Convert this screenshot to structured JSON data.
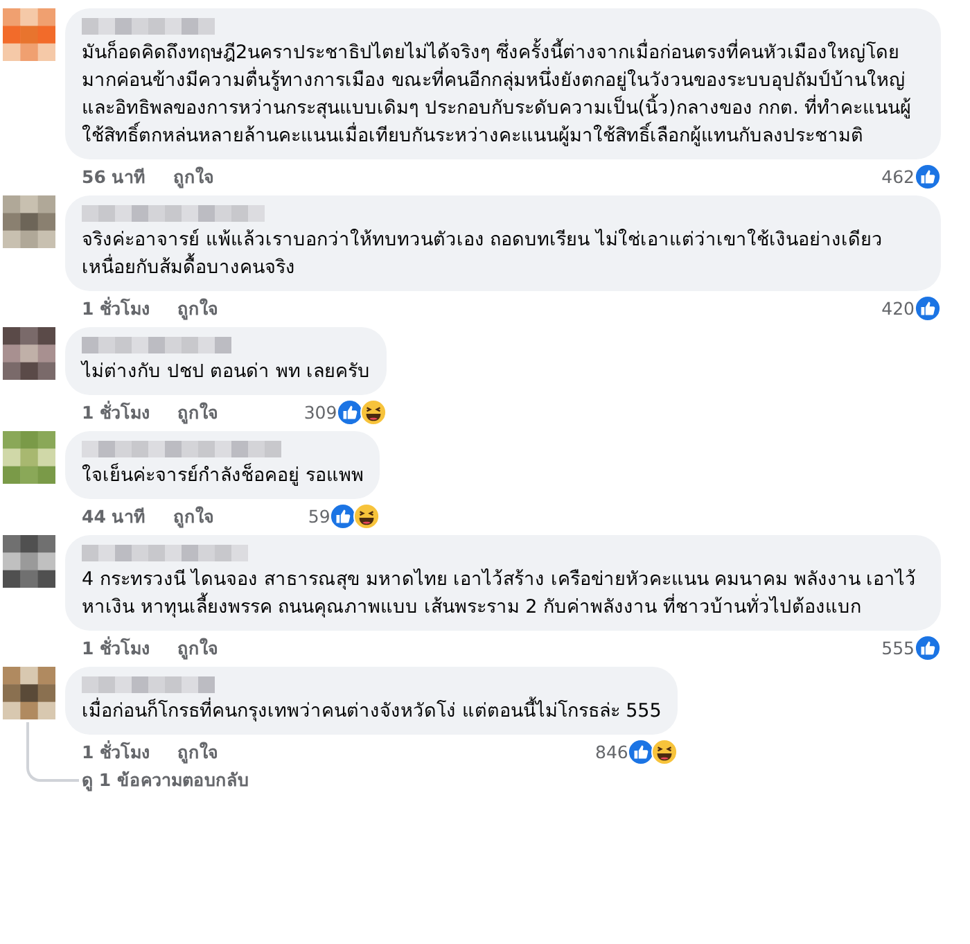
{
  "comments": [
    {
      "text": "มันก็อดคิดถึงทฤษฎี2นคราประชาธิปไตยไม่ได้จริงๆ ซึ่งครั้งนี้ต่างจากเมื่อก่อนตรงที่คนหัวเมืองใหญ่โดยมากค่อนข้างมีความตื่นรู้ทางการเมือง ขณะที่คนอีกกลุ่มหนึ่งยังตกอยู่ในวังวนของระบบอุปถัมป์บ้านใหญ่และอิทธิพลของการหว่านกระสุนแบบเดิมๆ ประกอบกับระดับความเป็น(นิ้ว)กลางของ กกต. ที่ทำคะแนนผู้ใช้สิทธิ์ตกหล่นหลายล้านคะแนนเมื่อเทียบกันระหว่างคะแนนผู้มาใช้สิทธิ์เลือกผู้แทนกับลงประชามติ",
      "time": "56 นาที",
      "like_label": "ถูกใจ",
      "reaction_count": "462",
      "reactions": [
        {
          "kind": "like"
        }
      ]
    },
    {
      "text": "จริงค่ะอาจารย์ แพ้แล้วเราบอกว่าให้ทบทวนตัวเอง ถอดบทเรียน ไม่ใช่เอาแต่ว่าเขาใช้เงินอย่างเดียว เหนื่อยกับส้มดื้อบางคนจริง",
      "time": "1 ชั่วโมง",
      "like_label": "ถูกใจ",
      "reaction_count": "420",
      "reactions": [
        {
          "kind": "like"
        }
      ]
    },
    {
      "text": "ไม่ต่างกับ ปชป ตอนด่า พท เลยครับ",
      "time": "1 ชั่วโมง",
      "like_label": "ถูกใจ",
      "reaction_count": "309",
      "reactions": [
        {
          "kind": "like"
        },
        {
          "kind": "haha"
        }
      ]
    },
    {
      "text": "ใจเย็นค่ะจารย์กำลังช็อคอยู่ รอแพพ",
      "time": "44 นาที",
      "like_label": "ถูกใจ",
      "reaction_count": "59",
      "reactions": [
        {
          "kind": "like"
        },
        {
          "kind": "haha"
        }
      ]
    },
    {
      "text": "4 กระทรวงนี ไดนจอง สาธารณสุข มหาดไทย เอาไว้สร้าง เครือข่ายหัวคะแนน คมนาคม พลังงาน เอาไว้หาเงิน หาทุนเลี้ยงพรรค ถนนคุณภาพแบบ เส้นพระราม 2 กับค่าพลังงาน ที่ชาวบ้านทั่วไปต้องแบก",
      "time": "1 ชั่วโมง",
      "like_label": "ถูกใจ",
      "reaction_count": "555",
      "reactions": [
        {
          "kind": "like"
        }
      ]
    },
    {
      "text": "เมื่อก่อนก็โกรธที่คนกรุงเทพว่าคนต่างจังหวัดโง่ แต่ตอนนี้ไม่โกรธล่ะ 555",
      "time": "1 ชั่วโมง",
      "like_label": "ถูกใจ",
      "reaction_count": "846",
      "reactions": [
        {
          "kind": "like"
        },
        {
          "kind": "haha"
        }
      ],
      "replies_link": "ดู 1 ข้อความตอบกลับ"
    }
  ]
}
